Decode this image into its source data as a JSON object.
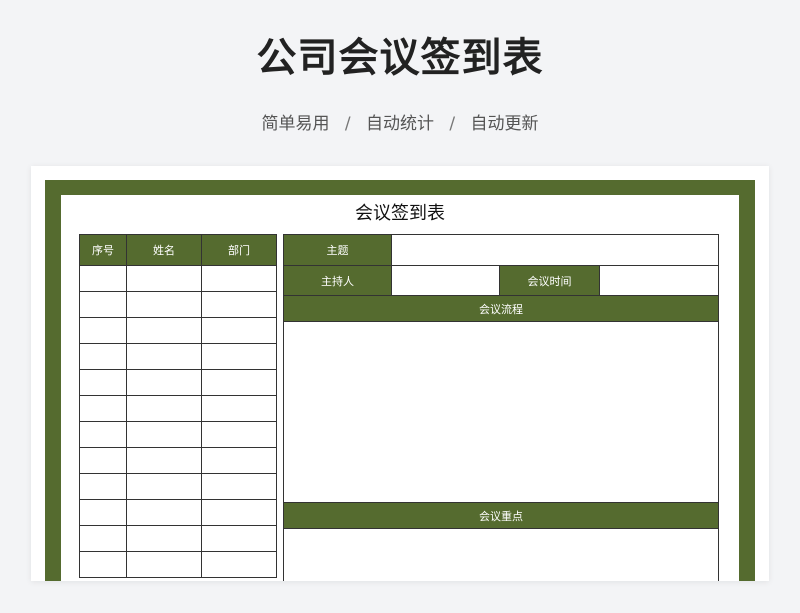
{
  "page": {
    "title": "公司会议签到表",
    "tagline": [
      "简单易用",
      "自动统计",
      "自动更新"
    ],
    "separator": "/"
  },
  "colors": {
    "accent": "#556b2f",
    "background": "#f3f4f6"
  },
  "sheet": {
    "title": "会议签到表",
    "attendees": {
      "columns": [
        "序号",
        "姓名",
        "部门"
      ],
      "rows": [
        [
          "",
          "",
          ""
        ],
        [
          "",
          "",
          ""
        ],
        [
          "",
          "",
          ""
        ],
        [
          "",
          "",
          ""
        ],
        [
          "",
          "",
          ""
        ],
        [
          "",
          "",
          ""
        ],
        [
          "",
          "",
          ""
        ],
        [
          "",
          "",
          ""
        ],
        [
          "",
          "",
          ""
        ],
        [
          "",
          "",
          ""
        ],
        [
          "",
          "",
          ""
        ],
        [
          "",
          "",
          ""
        ]
      ]
    },
    "meeting": {
      "topic_label": "主题",
      "topic_value": "",
      "host_label": "主持人",
      "host_value": "",
      "time_label": "会议时间",
      "time_value": "",
      "process_label": "会议流程",
      "process_value": "",
      "keypoints_label": "会议重点",
      "keypoints_value": ""
    }
  }
}
